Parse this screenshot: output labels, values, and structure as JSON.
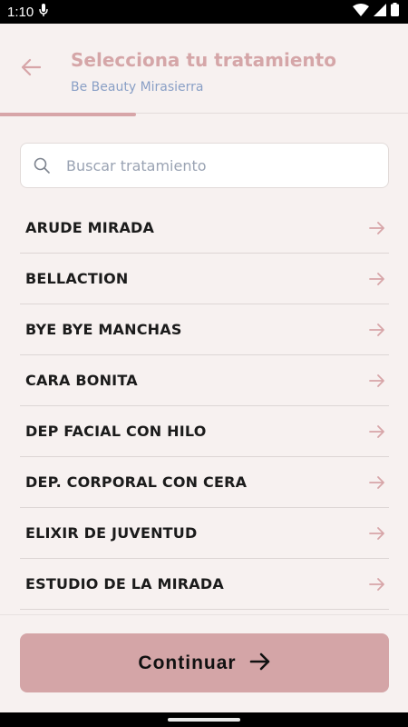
{
  "status_bar": {
    "time": "1:10",
    "icons": [
      "mic-icon",
      "wifi-icon",
      "signal-icon",
      "battery-icon"
    ]
  },
  "header": {
    "title": "Selecciona tu tratamiento",
    "subtitle": "Be Beauty Mirasierra",
    "back_icon": "back-arrow-icon",
    "progress": 0.333
  },
  "search": {
    "placeholder": "Buscar tratamiento",
    "value": "",
    "icon": "search-icon"
  },
  "treatments": [
    "ARUDE MIRADA",
    "BELLACTION",
    "BYE BYE MANCHAS",
    "CARA BONITA",
    "DEP FACIAL CON HILO",
    "DEP. CORPORAL CON CERA",
    "ELIXIR DE JUVENTUD",
    "ESTUDIO DE LA MIRADA"
  ],
  "footer": {
    "continue_label": "Continuar",
    "continue_icon": "arrow-right-icon"
  },
  "colors": {
    "accent": "#d4a5a7",
    "title": "#d5a6a8",
    "subtitle": "#8aa0c6",
    "background": "#f7f1f0"
  }
}
